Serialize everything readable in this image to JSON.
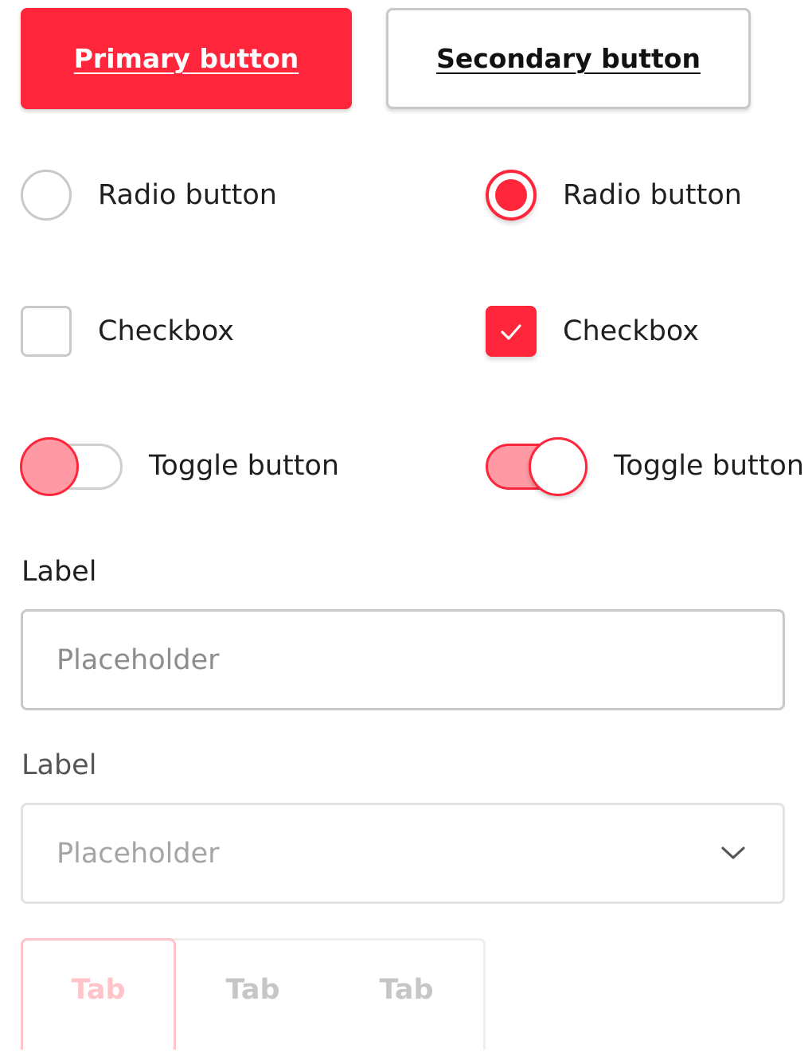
{
  "buttons": {
    "primary_label": "Primary button",
    "secondary_label": "Secondary button"
  },
  "radios": {
    "unchecked_label": "Radio button",
    "checked_label": "Radio button"
  },
  "checkboxes": {
    "unchecked_label": "Checkbox",
    "checked_label": "Checkbox"
  },
  "toggles": {
    "off_label": "Toggle button",
    "on_label": "Toggle button"
  },
  "text_field": {
    "label": "Label",
    "placeholder": "Placeholder"
  },
  "select_field": {
    "label": "Label",
    "placeholder": "Placeholder"
  },
  "tabs": [
    {
      "label": "Tab"
    },
    {
      "label": "Tab"
    },
    {
      "label": "Tab"
    }
  ],
  "colors": {
    "accent": "#ff253a",
    "accent_light": "#ff9aa4",
    "border": "#c8c8c8"
  }
}
